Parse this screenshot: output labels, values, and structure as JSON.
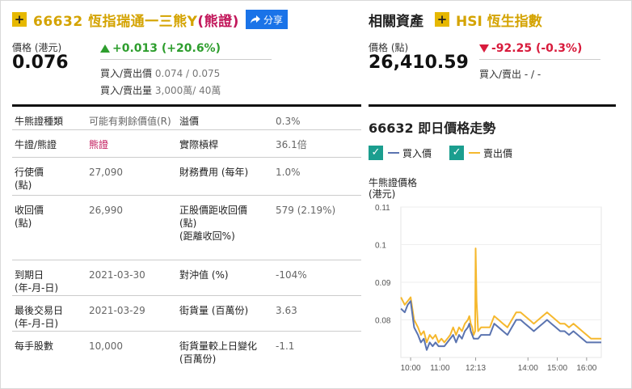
{
  "warrant": {
    "code": "66632",
    "name": "恆指瑞通一三熊Y",
    "type_open": "(",
    "type": "熊證",
    "type_close": ")",
    "share_label": "分享",
    "price_label": "價格 (港元)",
    "price": "0.076",
    "change": "+0.013 (+20.6%)",
    "bid_ask_label": "買入/賣出價",
    "bid_ask": "0.074 / 0.075",
    "bid_ask_vol_label": "買入/賣出量",
    "bid_ask_vol": "3,000萬/ 40萬"
  },
  "underlying": {
    "section_title": "相關資產",
    "name": "HSI 恆生指數",
    "price_label": "價格 (點)",
    "price": "26,410.59",
    "change": "-92.25 (-0.3%)",
    "bid_ask_label": "買入/賣出",
    "bid_ask": "- / -"
  },
  "details": [
    {
      "l1": "牛熊證種類",
      "v1": "可能有剩餘價值(R)",
      "l2": "溢價",
      "v2": "0.3%"
    },
    {
      "l1": "牛證/熊證",
      "v1": "熊證",
      "l2": "實際槓桿",
      "v2": "36.1倍"
    },
    {
      "l1": "行使價\n(點)",
      "v1": "27,090",
      "l2": "財務費用 (每年)",
      "v2": "1.0%"
    },
    {
      "l1": "收回價\n(點)",
      "v1": "26,990",
      "l2": "正股價距收回價\n(點)\n(距離收回%)",
      "v2": "579 (2.19%)"
    },
    {
      "l1": "到期日\n(年-月-日)",
      "v1": "2021-03-30",
      "l2": "對沖值 (%)",
      "v2": "-104%"
    },
    {
      "l1": "最後交易日\n(年-月-日)",
      "v1": "2021-03-29",
      "l2": "街貨量 (百萬份)",
      "v2": "3.63"
    },
    {
      "l1": "每手股數",
      "v1": "10,000",
      "l2": "街貨量較上日變化\n(百萬份)",
      "v2": "-1.1"
    }
  ],
  "chart": {
    "title": "66632 即日價格走勢",
    "legend_bid": "買入價",
    "legend_ask": "賣出價",
    "ylabel": "牛熊證價格\n(港元)",
    "colors": {
      "bid": "#5b74b0",
      "ask": "#f5b82e"
    }
  },
  "chart_data": {
    "type": "line",
    "title": "66632 即日價格走勢",
    "ylabel": "牛熊證價格 (港元)",
    "ylim": [
      0.07,
      0.11
    ],
    "yticks": [
      0.11,
      0.1,
      0.09,
      0.08
    ],
    "xlim": [
      9.667,
      16.5
    ],
    "xticks": [
      10,
      11,
      12.2167,
      14,
      15,
      16
    ],
    "xtick_labels": [
      "10:00",
      "11:00",
      "12:13",
      "14:00",
      "15:00",
      "16:00"
    ],
    "series": [
      {
        "name": "賣出價",
        "color": "#f5b82e",
        "x": [
          9.67,
          9.8,
          9.9,
          10.0,
          10.12,
          10.25,
          10.35,
          10.45,
          10.55,
          10.65,
          10.75,
          10.85,
          10.95,
          11.05,
          11.15,
          11.25,
          11.35,
          11.45,
          11.55,
          11.65,
          11.75,
          11.85,
          11.95,
          12.0,
          12.05,
          12.1,
          12.15,
          12.2,
          12.2167,
          12.25,
          12.3,
          12.4,
          12.55,
          12.7,
          12.85,
          13.0,
          13.15,
          13.3,
          13.45,
          13.6,
          13.75,
          13.9,
          14.05,
          14.2,
          14.35,
          14.5,
          14.65,
          14.8,
          14.95,
          15.1,
          15.25,
          15.4,
          15.55,
          15.7,
          15.85,
          16.0,
          16.15,
          16.3,
          16.5
        ],
        "y": [
          0.086,
          0.084,
          0.085,
          0.086,
          0.08,
          0.078,
          0.076,
          0.077,
          0.074,
          0.076,
          0.075,
          0.076,
          0.074,
          0.075,
          0.074,
          0.075,
          0.076,
          0.078,
          0.076,
          0.078,
          0.077,
          0.079,
          0.08,
          0.081,
          0.079,
          0.078,
          0.076,
          0.077,
          0.099,
          0.085,
          0.077,
          0.078,
          0.078,
          0.078,
          0.081,
          0.08,
          0.079,
          0.078,
          0.08,
          0.082,
          0.082,
          0.081,
          0.08,
          0.079,
          0.08,
          0.081,
          0.082,
          0.081,
          0.08,
          0.079,
          0.079,
          0.078,
          0.079,
          0.078,
          0.077,
          0.076,
          0.075,
          0.075,
          0.075
        ]
      },
      {
        "name": "買入價",
        "color": "#5b74b0",
        "x": [
          9.67,
          9.8,
          9.9,
          10.0,
          10.12,
          10.25,
          10.35,
          10.45,
          10.55,
          10.65,
          10.75,
          10.85,
          10.95,
          11.05,
          11.15,
          11.25,
          11.35,
          11.45,
          11.55,
          11.65,
          11.75,
          11.85,
          11.95,
          12.0,
          12.05,
          12.1,
          12.15,
          12.2,
          12.3,
          12.4,
          12.55,
          12.7,
          12.85,
          13.0,
          13.15,
          13.3,
          13.45,
          13.6,
          13.75,
          13.9,
          14.05,
          14.2,
          14.35,
          14.5,
          14.65,
          14.8,
          14.95,
          15.1,
          15.25,
          15.4,
          15.55,
          15.7,
          15.85,
          16.0,
          16.15,
          16.3,
          16.5
        ],
        "y": [
          0.083,
          0.082,
          0.084,
          0.085,
          0.078,
          0.076,
          0.074,
          0.075,
          0.072,
          0.074,
          0.073,
          0.074,
          0.073,
          0.073,
          0.073,
          0.074,
          0.075,
          0.076,
          0.074,
          0.076,
          0.075,
          0.077,
          0.078,
          0.079,
          0.077,
          0.076,
          0.075,
          0.075,
          0.075,
          0.076,
          0.076,
          0.076,
          0.079,
          0.078,
          0.077,
          0.076,
          0.078,
          0.08,
          0.08,
          0.079,
          0.078,
          0.077,
          0.078,
          0.079,
          0.08,
          0.079,
          0.078,
          0.077,
          0.077,
          0.076,
          0.077,
          0.076,
          0.075,
          0.074,
          0.074,
          0.074,
          0.074
        ]
      }
    ]
  }
}
